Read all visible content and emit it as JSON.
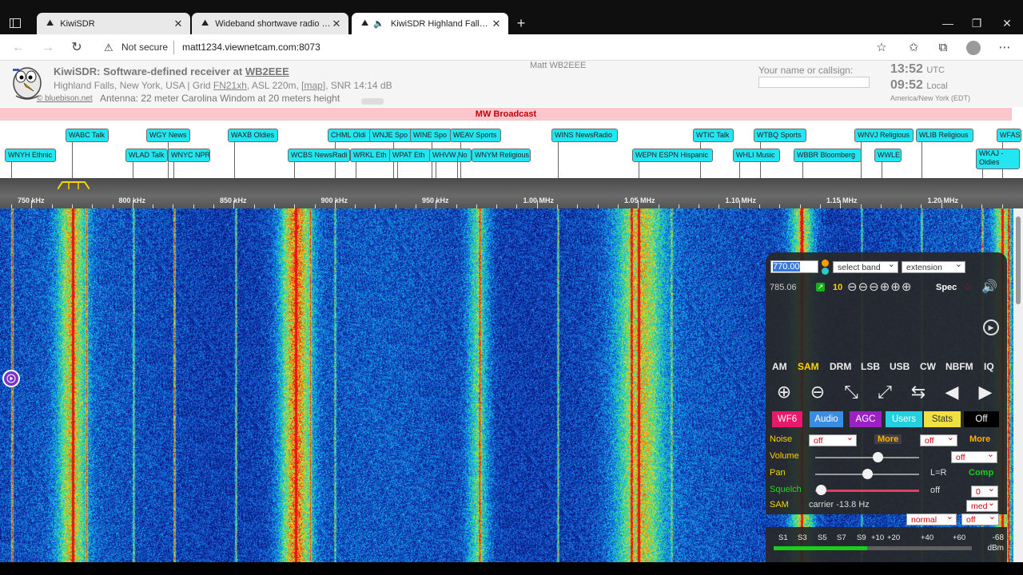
{
  "browser": {
    "tabs": [
      {
        "title": "KiwiSDR"
      },
      {
        "title": "Wideband shortwave radio receiver"
      },
      {
        "title": "KiwiSDR Highland Falls, New York"
      }
    ],
    "new_tab": "+",
    "address": {
      "security": "Not secure",
      "url": "matt1234.viewnetcam.com:8073"
    },
    "window_controls": {
      "minimize": "—",
      "restore": "❐",
      "close": "✕"
    }
  },
  "header": {
    "title_prefix": "KiwiSDR: Software-defined receiver at ",
    "title_call": "WB2EEE",
    "location_prefix": "Highland Falls, New York, USA | Grid ",
    "grid": "FN21xh",
    "asl": ", ASL 220m, [",
    "map": "map",
    "snr": "], SNR 14:14 dB",
    "logo_credit": "© bluebison.net",
    "antenna": "Antenna: 22 meter Carolina Windom at 20 meters height",
    "owner": "Matt WB2EEE",
    "callsign_label": "Your name or callsign:",
    "callsign_value": "",
    "utc_time": "13:52",
    "utc_label": "UTC",
    "local_time": "09:52",
    "local_label": "Local",
    "timezone": "America/New York (EDT)"
  },
  "band_name": "MW Broadcast",
  "dx_labels_row1": [
    "WABC Talk",
    "WGY News",
    "WAXB Oldies",
    "CHML Oldi",
    "WNJE Spo",
    "WINE Spo",
    "WEAV Sports",
    "WINS NewsRadio",
    "WTIC Talk",
    "WTBQ Sports",
    "WNVJ Religious",
    "WLIB Religious",
    "WFAS Talk"
  ],
  "dx_labels_row2": [
    "WNYH Ethnic",
    "WLAD Talk",
    "WNYC NPR",
    "WCBS NewsRadi",
    "WRKL Eth",
    "WPAT Eth",
    "WHVW No",
    "WNYM Religious",
    "WEPN ESPN Hispanic",
    "WHLI Music",
    "WBBR Bloomberg",
    "WWLE",
    "WKAJ - Oldies"
  ],
  "scale_labels": [
    "750 kHz",
    "800 kHz",
    "850 kHz",
    "900 kHz",
    "950 kHz",
    "1.00 MHz",
    "1.05 MHz",
    "1.10 MHz",
    "1.15 MHz",
    "1.20 MHz"
  ],
  "panel": {
    "frequency": "770.00",
    "band_select": "select band",
    "extension_select": "extension",
    "cursor_freq": "785.06",
    "zoom_level": "10",
    "spec_label": "Spec",
    "modes": [
      "AM",
      "SAM",
      "DRM",
      "LSB",
      "USB",
      "CW",
      "NBFM",
      "IQ"
    ],
    "active_mode": "SAM",
    "tabs": [
      "WF6",
      "Audio",
      "AGC",
      "Users",
      "Stats",
      "Off"
    ],
    "noise_label": "Noise",
    "noise_select_1": "off",
    "noise_more_1": "More",
    "noise_select_2": "off",
    "noise_more_2": "More",
    "volume_label": "Volume",
    "volume_select": "off",
    "volume_level": 0.6,
    "pan_label": "Pan",
    "pan_value": "L=R",
    "pan_level": 0.5,
    "comp_label": "Comp",
    "squelch_label": "Squelch",
    "squelch_value": "off",
    "squelch_select": "0",
    "squelch_level": 0.05,
    "sam_label": "SAM",
    "sam_carrier": "carrier -13.8 Hz",
    "sam_select_1": "med",
    "sam_select_2": "normal",
    "sam_select_3": "off",
    "smeter_labels": [
      "S1",
      "S3",
      "S5",
      "S7",
      "S9",
      "+10",
      "+20",
      "+40",
      "+60"
    ],
    "smeter_value": "-68",
    "smeter_unit": "dBm",
    "smeter_level": 0.47
  },
  "colors": {
    "band_strip": "#fbc6cc",
    "dx_label": "#24e6f0",
    "panel_bg": "#282828",
    "active_mode": "#ffd400"
  }
}
